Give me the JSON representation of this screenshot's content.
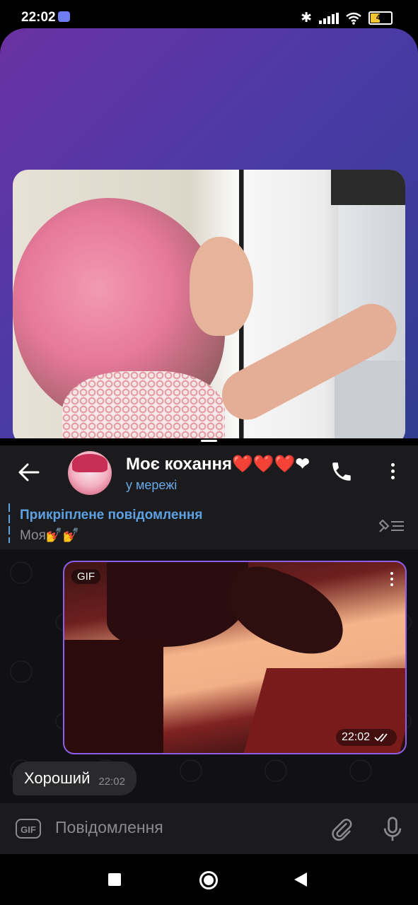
{
  "status_bar": {
    "time": "22:02",
    "battery": "42"
  },
  "chat_header": {
    "title": "Моє кохання❤️❤️❤️❤",
    "status": "у мережі"
  },
  "pinned": {
    "title": "Прикріплене повідомлення",
    "text": "Моя💅💅"
  },
  "gif_message": {
    "badge": "GIF",
    "time": "22:02"
  },
  "text_message": {
    "text": "Хороший",
    "time": "22:02"
  },
  "composer": {
    "gif_label": "GIF",
    "placeholder": "Повідомлення"
  },
  "colors": {
    "accent": "#5ea1e3",
    "bubble_outline": "#8d5ee8",
    "header_bg": "#1b1b1d"
  },
  "icons": [
    "discord-icon",
    "bluetooth-icon",
    "signal-icon",
    "wifi-icon",
    "battery-icon",
    "back-arrow-icon",
    "phone-icon",
    "more-vert-icon",
    "pin-list-icon",
    "attach-icon",
    "mic-icon"
  ]
}
